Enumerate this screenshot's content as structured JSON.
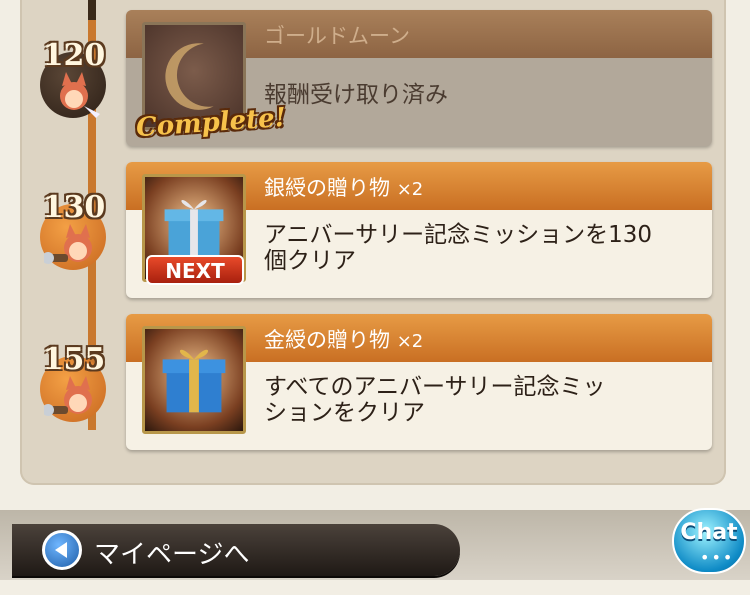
{
  "missions": [
    {
      "level": "120",
      "reward_title": "ゴールドムーン",
      "quantity": "",
      "description": "報酬受け取り済み",
      "status_label": "Complete!",
      "icon": "gold-moon-icon",
      "completed": true
    },
    {
      "level": "130",
      "reward_title": "銀綬の贈り物",
      "quantity": "×2",
      "description_line1": "アニバーサリー記念ミッションを130",
      "description_line2": "個クリア",
      "status_label": "NEXT",
      "icon": "silver-gift-icon",
      "completed": false
    },
    {
      "level": "155",
      "reward_title": "金綬の贈り物",
      "quantity": "×2",
      "description_line1": "すべてのアニバーサリー記念ミッ",
      "description_line2": "ションをクリア",
      "icon": "gold-gift-icon",
      "completed": false
    }
  ],
  "footer": {
    "mypage_label": "マイページへ",
    "chat_label": "Chat",
    "chat_dots": "•••"
  },
  "colors": {
    "accent_orange": "#d7832f",
    "completed_brown": "#8d6443",
    "panel_bg": "#ddd4c3"
  }
}
